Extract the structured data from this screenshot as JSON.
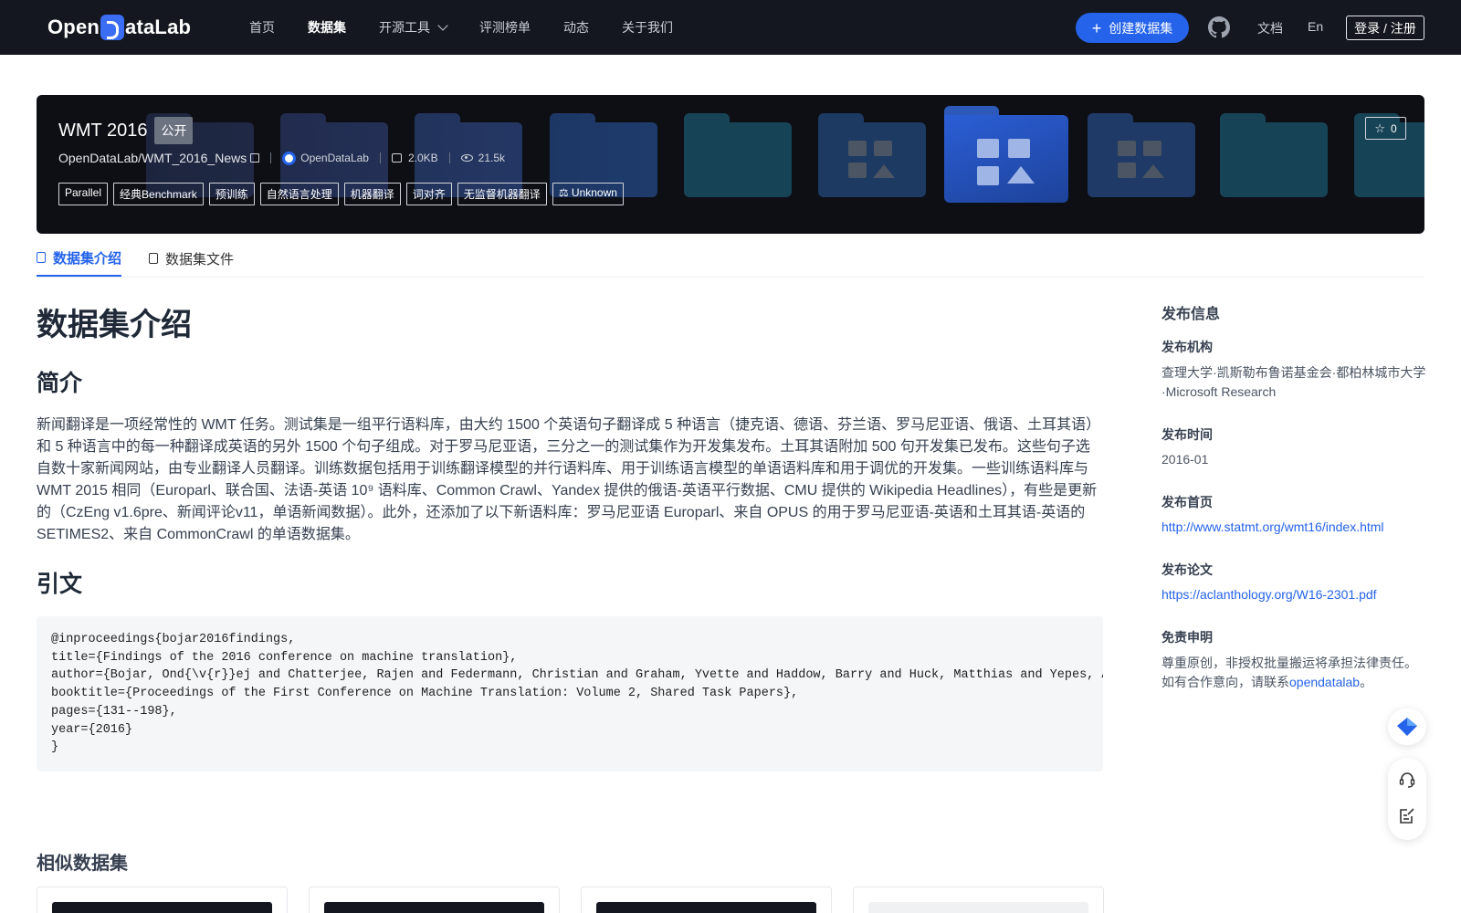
{
  "header": {
    "logo_text_left": "Open",
    "logo_text_right": "ataLab",
    "nav": [
      {
        "label": "首页",
        "active": false
      },
      {
        "label": "数据集",
        "active": true
      },
      {
        "label": "开源工具",
        "active": false,
        "has_dropdown": true
      },
      {
        "label": "评测榜单",
        "active": false
      },
      {
        "label": "动态",
        "active": false
      },
      {
        "label": "关于我们",
        "active": false
      }
    ],
    "create_button": "创建数据集",
    "github_icon": "github-icon",
    "docs_link": "文档",
    "lang_link": "En",
    "login_button": "登录 / 注册"
  },
  "dataset": {
    "title": "WMT 2016",
    "visibility": "公开",
    "repo": "OpenDataLab/WMT_2016_News",
    "org": "OpenDataLab",
    "size": "2.0KB",
    "views": "21.5k",
    "tags": [
      "Parallel",
      "经典Benchmark",
      "预训练",
      "自然语言处理",
      "机器翻译",
      "词对齐",
      "无监督机器翻译"
    ],
    "license": "Unknown",
    "stars": "0"
  },
  "tabs": [
    {
      "label": "数据集介绍",
      "active": true
    },
    {
      "label": "数据集文件",
      "active": false
    }
  ],
  "content": {
    "heading": "数据集介绍",
    "summary_heading": "简介",
    "summary": "新闻翻译是一项经常性的 WMT 任务。测试集是一组平行语料库，由大约 1500 个英语句子翻译成 5 种语言（捷克语、德语、芬兰语、罗马尼亚语、俄语、土耳其语）和 5 种语言中的每一种翻译成英语的另外 1500 个句子组成。对于罗马尼亚语，三分之一的测试集作为开发集发布。土耳其语附加 500 句开发集已发布。这些句子选自数十家新闻网站，由专业翻译人员翻译。训练数据包括用于训练翻译模型的并行语料库、用于训练语言模型的单语语料库和用于调优的开发集。一些训练语料库与 WMT 2015 相同（Europarl、联合国、法语-英语 10⁹ 语料库、Common Crawl、Yandex 提供的俄语-英语平行数据、CMU 提供的 Wikipedia Headlines），有些是更新的（CzEng v1.6pre、新闻评论v11，单语新闻数据）。此外，还添加了以下新语料库：罗马尼亚语 Europarl、来自 OPUS 的用于罗马尼亚语-英语和土耳其语-英语的 SETIMES2、来自 CommonCrawl 的单语数据集。",
    "citation_heading": "引文",
    "citation_lines": [
      "@inproceedings{bojar2016findings,",
      "title={Findings of the 2016 conference on machine translation},",
      "author={Bojar, Ond{\\v{r}}ej and Chatterjee, Rajen and Federmann, Christian and Graham, Yvette and Haddow, Barry and Huck, Matthias and Yepes, Antonio Jimeno and Koehn, Philipp and Logacheva, Varvara and Monz, Christof and others},",
      "booktitle={Proceedings of the First Conference on Machine Translation: Volume 2, Shared Task Papers},",
      "pages={131--198},",
      "year={2016}",
      "}"
    ]
  },
  "sidebar": {
    "title": "发布信息",
    "publisher_label": "发布机构",
    "publisher_value": "查理大学·凯斯勒布鲁诺基金会·都柏林城市大学·Microsoft Research",
    "date_label": "发布时间",
    "date_value": "2016-01",
    "homepage_label": "发布首页",
    "homepage_value": "http://www.statmt.org/wmt16/index.html",
    "paper_label": "发布论文",
    "paper_value": "https://aclanthology.org/W16-2301.pdf",
    "disclaimer_label": "免责申明",
    "disclaimer_text": "尊重原创，非授权批量搬运将承担法律责任。如有合作意向，请联系",
    "disclaimer_link": "opendatalab",
    "disclaimer_end": "。"
  },
  "similar": {
    "title": "相似数据集"
  },
  "colors": {
    "accent": "#2563eb",
    "header_bg": "#14171f",
    "banner_bg": "#0d0f15"
  }
}
